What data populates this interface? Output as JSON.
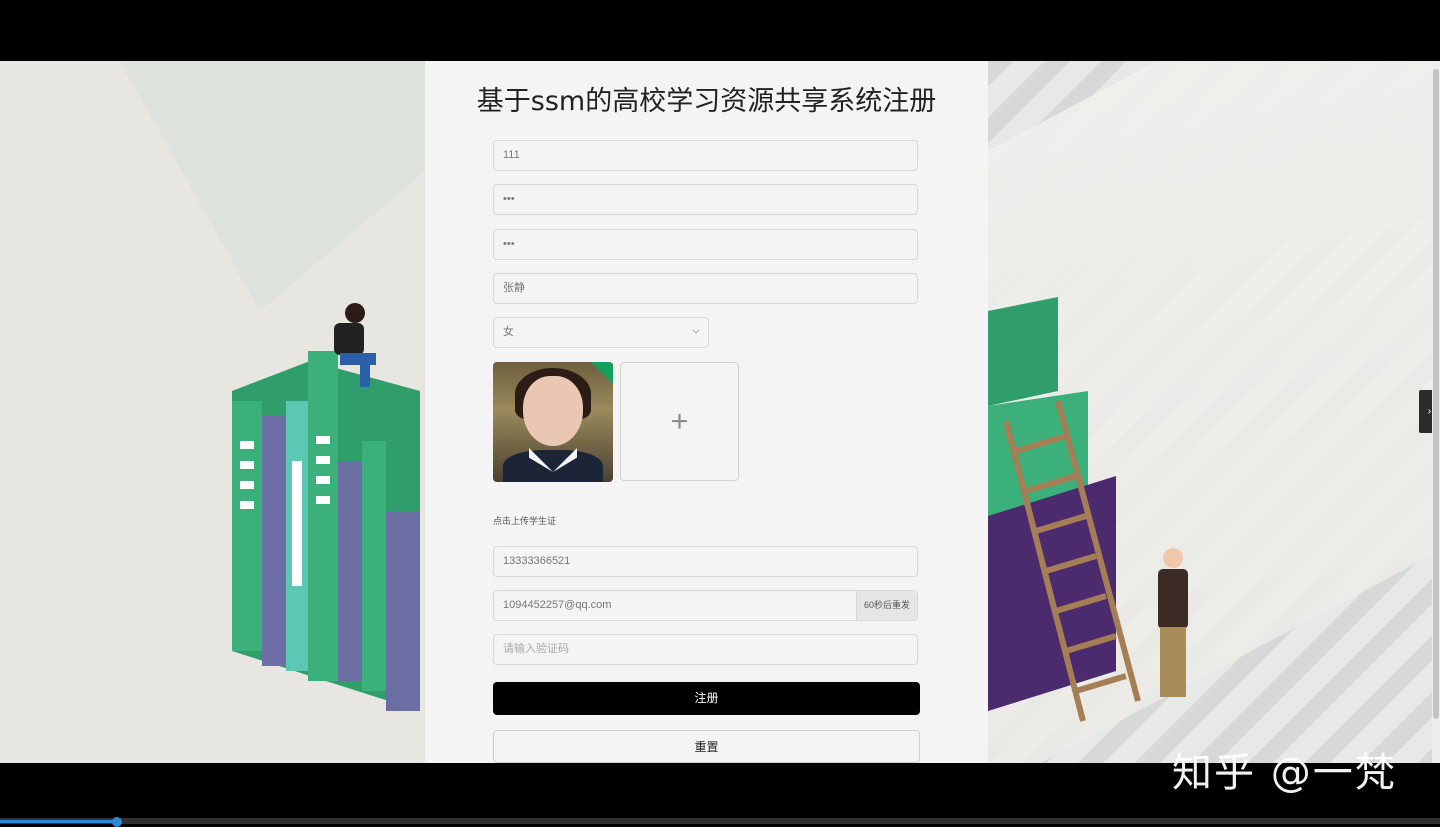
{
  "page": {
    "title": "基于ssm的高校学习资源共享系统注册"
  },
  "form": {
    "username": "111",
    "password": "•••",
    "confirm_password": "•••",
    "name": "张静",
    "gender": "女",
    "upload_hint": "点击上传学生证",
    "upload_plus": "+",
    "phone": "13333366521",
    "email": "1094452257@qq.com",
    "resend_label": "60秒后重发",
    "code_placeholder": "请输入验证码",
    "register_label": "注册",
    "reset_label": "重置"
  },
  "icons": {
    "gender_dropdown": "chevron-down-icon",
    "side_toggle": "chevron-right-icon"
  },
  "side_toggle_glyph": "›",
  "watermark": "知乎 @一梵",
  "colors": {
    "primary_button": "#000000",
    "panel": "#f4f4f4",
    "badge": "#13a05a"
  },
  "video_progress": 0.08
}
